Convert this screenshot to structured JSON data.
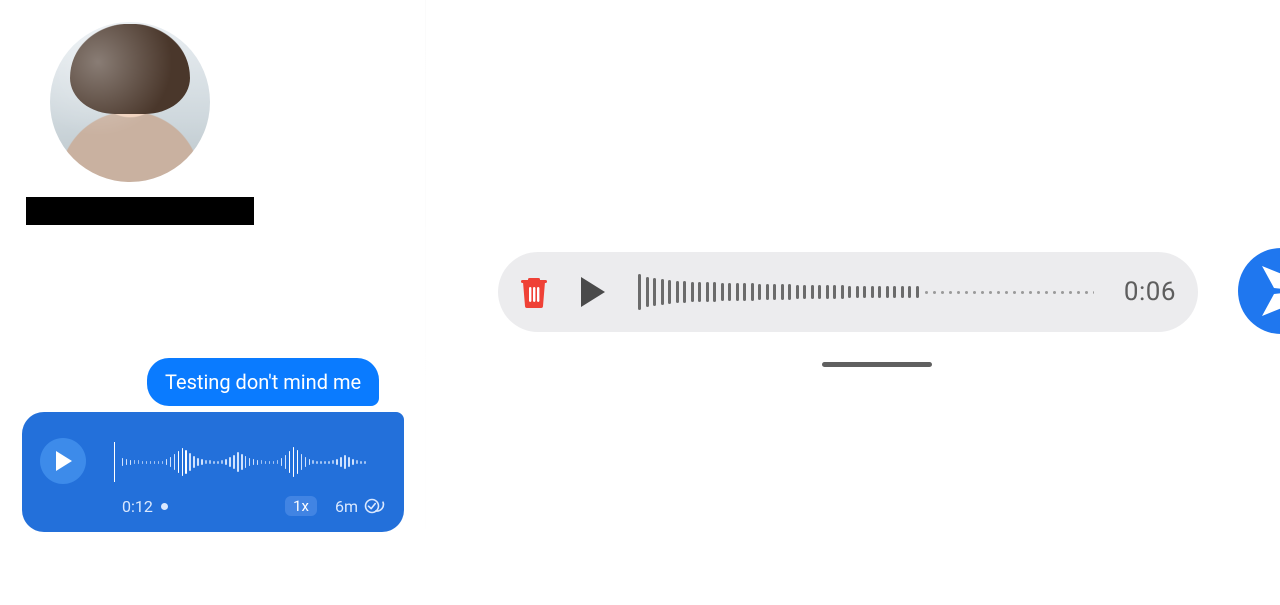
{
  "left": {
    "chat": {
      "sent_text": "Testing don't mind me",
      "voice_message": {
        "duration": "0:12",
        "playback_speed": "1x",
        "age": "6m"
      }
    }
  },
  "right": {
    "recording": {
      "elapsed": "0:06"
    }
  },
  "colors": {
    "brand_blue": "#0a7bff",
    "bubble_blue": "#1f70e0",
    "send_blue": "#1f77ef",
    "danger_red": "#ef4136",
    "rec_bg": "#ececee"
  }
}
